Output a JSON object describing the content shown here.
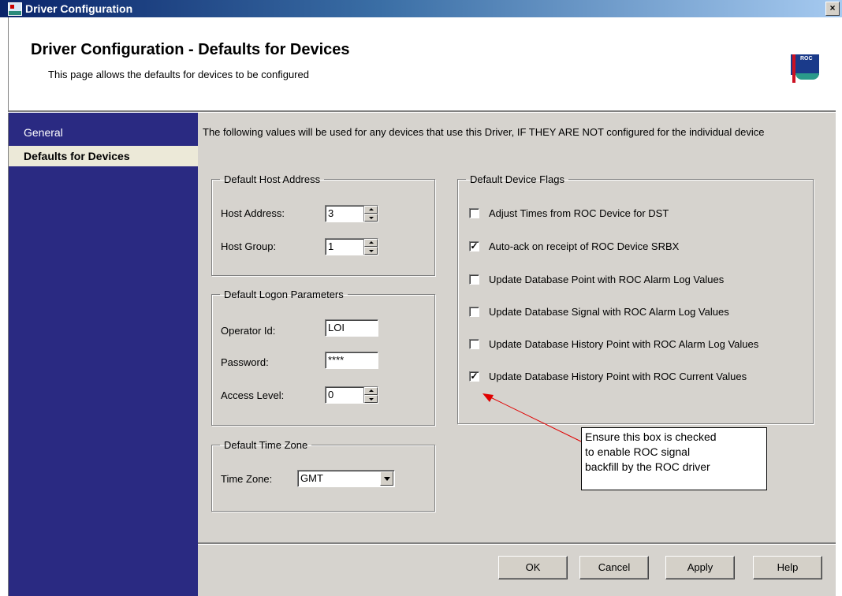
{
  "window": {
    "title": "Driver Configuration",
    "close_glyph": "×"
  },
  "header": {
    "title": "Driver Configuration - Defaults for Devices",
    "subtitle": "This page allows the defaults for devices to be configured",
    "logo_text": "ROC"
  },
  "sidebar": {
    "items": [
      {
        "label": "General",
        "active": false
      },
      {
        "label": "Defaults for Devices",
        "active": true
      }
    ]
  },
  "intro": "The following values will be used for any devices that use this Driver, IF THEY ARE NOT configured for the individual device",
  "host_address": {
    "legend": "Default Host Address",
    "host_address_label": "Host Address:",
    "host_address_value": "3",
    "host_group_label": "Host Group:",
    "host_group_value": "1"
  },
  "logon": {
    "legend": "Default Logon Parameters",
    "operator_label": "Operator Id:",
    "operator_value": "LOI",
    "password_label": "Password:",
    "password_value": "****",
    "access_label": "Access Level:",
    "access_value": "0"
  },
  "timezone": {
    "legend": "Default Time Zone",
    "label": "Time Zone:",
    "value": "GMT"
  },
  "flags": {
    "legend": "Default Device Flags",
    "items": [
      {
        "label": "Adjust Times from ROC Device for DST",
        "checked": false,
        "mark": ""
      },
      {
        "label": "Auto-ack on receipt of ROC Device SRBX",
        "checked": true,
        "mark": "✓"
      },
      {
        "label": "Update Database Point with ROC Alarm Log Values",
        "checked": false,
        "mark": ""
      },
      {
        "label": "Update Database Signal with ROC Alarm Log Values",
        "checked": false,
        "mark": ""
      },
      {
        "label": "Update Database History Point with ROC Alarm Log Values",
        "checked": false,
        "mark": ""
      },
      {
        "label": "Update Database History Point with ROC Current Values",
        "checked": true,
        "mark": "✓"
      }
    ]
  },
  "callout": {
    "lines": [
      "Ensure this box is checked",
      "to enable ROC signal",
      "backfill by the ROC driver"
    ],
    "arrow_color": "#e00000"
  },
  "buttons": {
    "ok": "OK",
    "cancel": "Cancel",
    "apply": "Apply",
    "help": "Help"
  },
  "colors": {
    "sidebar": "#2a2a82",
    "panel": "#d6d3ce",
    "active_item": "#ece9d8"
  }
}
